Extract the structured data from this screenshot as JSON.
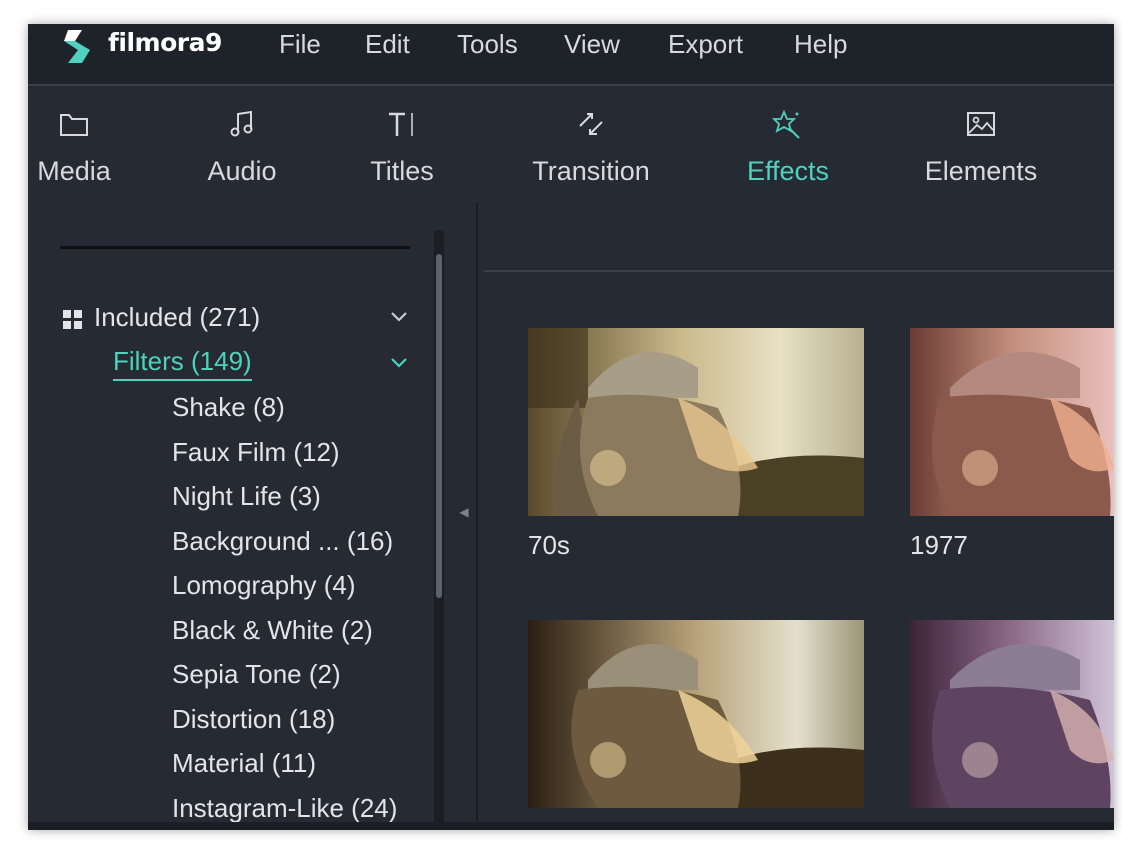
{
  "app": {
    "brand": "filmora9",
    "accent_color": "#4fd1bd",
    "background_color": "#252a33"
  },
  "menu": {
    "file": "File",
    "edit": "Edit",
    "tools": "Tools",
    "view": "View",
    "export": "Export",
    "help": "Help"
  },
  "tabs": {
    "media": {
      "label": "Media",
      "icon": "folder-icon"
    },
    "audio": {
      "label": "Audio",
      "icon": "music-note-icon"
    },
    "titles": {
      "label": "Titles",
      "icon": "text-icon"
    },
    "transition": {
      "label": "Transition",
      "icon": "transition-icon"
    },
    "effects": {
      "label": "Effects",
      "icon": "effects-icon",
      "active": true
    },
    "elements": {
      "label": "Elements",
      "icon": "image-icon"
    }
  },
  "sidebar": {
    "included": {
      "label": "Included (271)",
      "expanded": true
    },
    "filters": {
      "label": "Filters (149)",
      "expanded": true,
      "selected": true
    },
    "items": [
      {
        "label": "Shake (8)"
      },
      {
        "label": "Faux Film (12)"
      },
      {
        "label": "Night Life (3)"
      },
      {
        "label": "Background ... (16)"
      },
      {
        "label": "Lomography (4)"
      },
      {
        "label": "Black & White (2)"
      },
      {
        "label": "Sepia Tone (2)"
      },
      {
        "label": "Distortion (18)"
      },
      {
        "label": "Material (11)"
      },
      {
        "label": "Instagram-Like (24)"
      }
    ]
  },
  "effects": [
    {
      "name": "70s"
    },
    {
      "name": "1977"
    }
  ]
}
